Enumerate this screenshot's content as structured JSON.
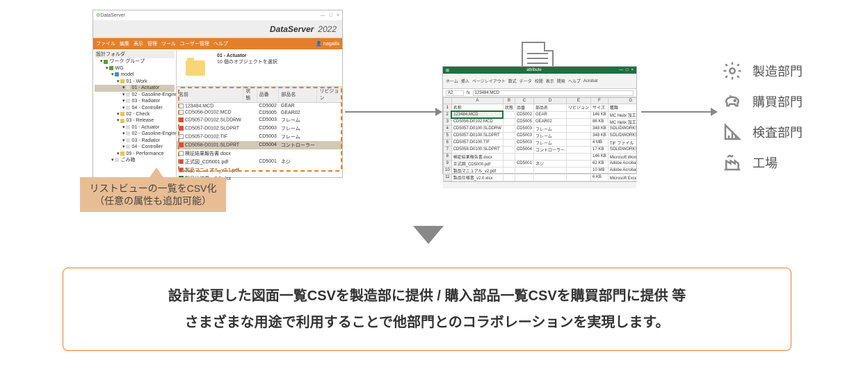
{
  "ds": {
    "app_title": "DataServer",
    "brand": "DataServer",
    "year": "2022",
    "menus": [
      "ファイル",
      "編集",
      "表示",
      "管理",
      "ツール",
      "ユーザー管理",
      "ヘルプ"
    ],
    "user": "nagaifa",
    "tree_header": "設計フォルダ",
    "tree": [
      {
        "label": "ワーク グループ",
        "indent": 0,
        "color": "g"
      },
      {
        "label": "WG",
        "indent": 1,
        "color": "g"
      },
      {
        "label": "model",
        "indent": 2,
        "color": "b"
      },
      {
        "label": "01 - Work",
        "indent": 3,
        "color": "y"
      },
      {
        "label": "01 - Actuator",
        "indent": 4,
        "selected": true
      },
      {
        "label": "02 - Gasoline-Engine",
        "indent": 4
      },
      {
        "label": "03 - Radiator",
        "indent": 4
      },
      {
        "label": "04 - Controller",
        "indent": 4
      },
      {
        "label": "02 - Check",
        "indent": 3,
        "color": "y"
      },
      {
        "label": "03 - Release",
        "indent": 3,
        "color": "y"
      },
      {
        "label": "01 - Actuator",
        "indent": 4
      },
      {
        "label": "02 - Gasoline-Engine",
        "indent": 4
      },
      {
        "label": "03 - Radiator",
        "indent": 4
      },
      {
        "label": "04 - Controller",
        "indent": 4
      },
      {
        "label": "09 - Performance",
        "indent": 3,
        "color": "y"
      },
      {
        "label": "ごみ箱",
        "indent": 2
      }
    ],
    "right_title": "01 - Actuator",
    "right_sub": "10 個のオブジェクトを選択",
    "columns": [
      "名前",
      "状態",
      "品番",
      "部品名",
      "リビジョン"
    ],
    "rows": [
      {
        "name": "123484.MCD",
        "code": "CD5002",
        "part": "GEAR",
        "ico": "doc"
      },
      {
        "name": "CD5056-D0102.MCD",
        "code": "CD5005",
        "part": "GEAR02",
        "ico": "doc"
      },
      {
        "name": "CD5057-D0102.SLDDRW",
        "code": "CD5003",
        "part": "フレーム",
        "ico": "sw"
      },
      {
        "name": "CD5057-D0102.SLDPRT",
        "code": "CD5003",
        "part": "フレーム",
        "ico": "sw"
      },
      {
        "name": "CD5057-D0102.TIF",
        "code": "CD5003",
        "part": "フレーム",
        "ico": "doc"
      },
      {
        "name": "CD5058-D0101.SLDPRT",
        "code": "CD5004",
        "part": "コントローラー",
        "ico": "sw",
        "selected": true
      },
      {
        "name": "検証結果報告書.docx",
        "code": "",
        "part": "",
        "ico": "doc"
      },
      {
        "name": "正式図_CD5001.pdf",
        "code": "CD5001",
        "part": "ネジ",
        "ico": "pdf"
      },
      {
        "name": "製品マニュアル_v2.1.pdf",
        "code": "",
        "part": "",
        "ico": "pdf"
      },
      {
        "name": "製品仕様書_v2.0.xlsx",
        "code": "",
        "part": "",
        "ico": "xl"
      }
    ]
  },
  "callout": {
    "line1": "リストビューの一覧をCSV化",
    "line2": "（任意の属性も追加可能）"
  },
  "excel": {
    "filename": "attribute",
    "ribbon": [
      "ホーム",
      "挿入",
      "ページレイアウト",
      "数式",
      "データ",
      "校閲",
      "表示",
      "開発",
      "ヘルプ",
      "Acrobat"
    ],
    "cellref": "A2",
    "fxvalue": "123484.MCD",
    "col_letters": [
      "A",
      "B",
      "C",
      "D",
      "E",
      "F",
      "G"
    ],
    "headers": [
      "名称",
      "状態",
      "品番",
      "部品名",
      "リビジョン",
      "サイズ",
      "種類"
    ],
    "rows": [
      [
        "123484.MCD",
        "",
        "CD5002",
        "GEAR",
        "",
        "146 KB",
        "MC Helix 加工"
      ],
      [
        "CD5056-D0102.MCD",
        "",
        "CD5005",
        "GEAR02",
        "",
        "86 KB",
        "MC Helix 加工"
      ],
      [
        "CD5057-D0100.SLDDRW",
        "",
        "CD5003",
        "フレーム",
        "",
        "348 KB",
        "SOLIDWORKS Drawi"
      ],
      [
        "CD5057-D0100.SLDPRT",
        "",
        "CD5003",
        "フレーム",
        "",
        "348 KB",
        "SOLIDWORKS Part D"
      ],
      [
        "CD5057-D0100.TIF",
        "",
        "CD5003",
        "フレーム",
        "",
        "4 MB",
        "TIF ファイル"
      ],
      [
        "CD5058-D0100.SLDPRT",
        "",
        "CD5004",
        "コントローラー",
        "",
        "17 KB",
        "SOLIDWORKS Part D"
      ],
      [
        "検証結果報告書.docx",
        "",
        "",
        "",
        "",
        "146 KB",
        "Microsoft Word 文書"
      ],
      [
        "正式図_CD5000.pdf",
        "",
        "CD5001",
        "ネジ",
        "",
        "62 KB",
        "Adobe Acrobat Docum"
      ],
      [
        "製品マニュアル_v2.pdf",
        "",
        "",
        "",
        "",
        "10 MB",
        "Adobe Acrobat Docum"
      ],
      [
        "製品仕様書_v2.0.xlsx",
        "",
        "",
        "",
        "",
        "6 KB",
        "Microsoft Excel ワーク"
      ]
    ]
  },
  "departments": [
    {
      "icon": "gear",
      "label": "製造部門"
    },
    {
      "icon": "piggy",
      "label": "購買部門"
    },
    {
      "icon": "ruler",
      "label": "検査部門"
    },
    {
      "icon": "factory",
      "label": "工場"
    }
  ],
  "bottom": {
    "line1": "設計変更した図面一覧CSVを製造部に提供 / 購入部品一覧CSVを購買部門に提供 等",
    "line2": "さまざまな用途で利用することで他部門とのコラボレーションを実現します。"
  }
}
